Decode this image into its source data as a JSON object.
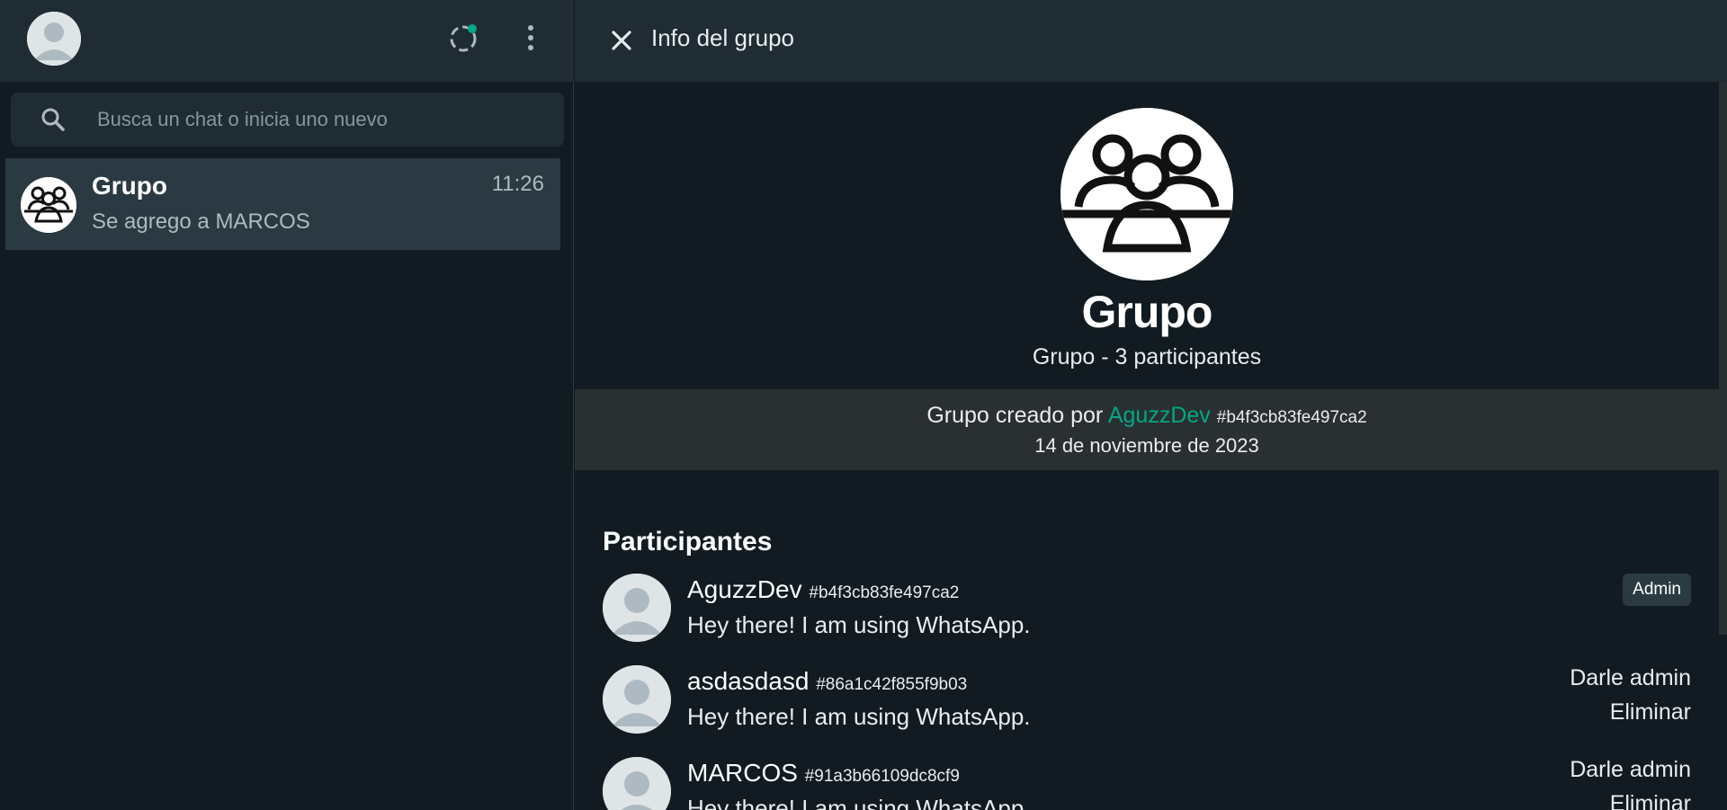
{
  "sidebar": {
    "search": {
      "placeholder": "Busca un chat o inicia uno nuevo",
      "value": ""
    },
    "chats": [
      {
        "name": "Grupo",
        "time": "11:26",
        "last_message": "Se agrego a MARCOS"
      }
    ]
  },
  "group_info": {
    "header_title": "Info del grupo",
    "name": "Grupo",
    "subtitle": "Grupo - 3 participantes",
    "created_prefix": "Grupo creado por",
    "created_by": "AguzzDev",
    "created_by_hash": "#b4f3cb83fe497ca2",
    "created_date": "14 de noviembre de 2023",
    "participants_title": "Participantes",
    "participants": [
      {
        "name": "AguzzDev",
        "hash": "#b4f3cb83fe497ca2",
        "status": "Hey there! I am using WhatsApp.",
        "badge": "Admin"
      },
      {
        "name": "asdasdasd",
        "hash": "#86a1c42f855f9b03",
        "status": "Hey there! I am using WhatsApp.",
        "action_admin": "Darle admin",
        "action_remove": "Eliminar"
      },
      {
        "name": "MARCOS",
        "hash": "#91a3b66109dc8cf9",
        "status": "Hey there! I am using WhatsApp.",
        "action_admin": "Darle admin",
        "action_remove": "Eliminar"
      }
    ]
  },
  "colors": {
    "accent": "#00a884",
    "panel": "#202c33",
    "background": "#111b21",
    "selected": "#2a3942"
  },
  "icons": [
    "avatar-icon",
    "status-icon",
    "menu-icon",
    "search-icon",
    "close-icon",
    "group-icon"
  ]
}
